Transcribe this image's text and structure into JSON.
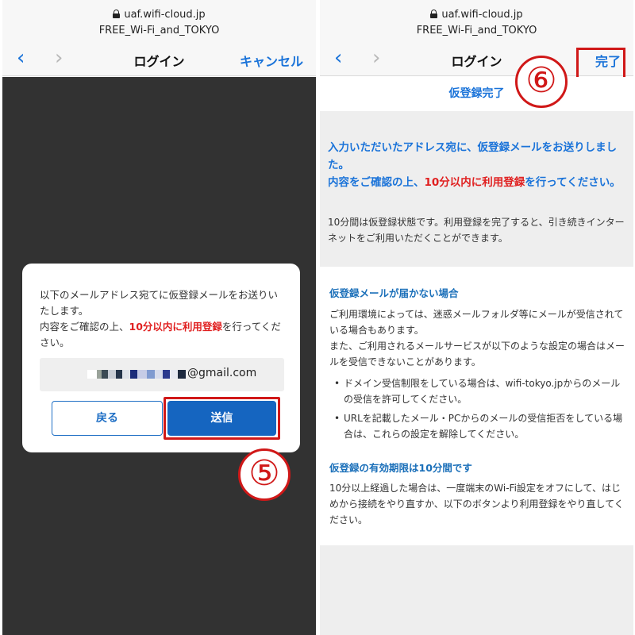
{
  "left": {
    "url": "uaf.wifi-cloud.jp",
    "ssid": "FREE_Wi-Fi_and_TOKYO",
    "nav_back": "‹",
    "nav_forward": "›",
    "nav_title": "ログイン",
    "nav_action": "キャンセル",
    "dialog": {
      "text_line1": "以下のメールアドレス宛てに仮登録メールをお送りいたします。",
      "text_prefix": "内容をご確認の上、",
      "text_highlight": "10分以内に利用登録",
      "text_suffix": "を行ってください。",
      "email_domain": "@gmail.com",
      "back_label": "戻る",
      "send_label": "送信"
    },
    "step_badge": "⑤"
  },
  "right": {
    "url": "uaf.wifi-cloud.jp",
    "ssid": "FREE_Wi-Fi_and_TOKYO",
    "nav_back": "‹",
    "nav_forward": "›",
    "nav_title": "ログイン",
    "nav_action": "完了",
    "step_badge": "⑥",
    "reg_title": "仮登録完了",
    "lead_line1": "入力いただいたアドレス宛に、仮登録メールをお送りしました。",
    "lead_prefix": "内容をご確認の上、",
    "lead_highlight": "10分以内に利用登録",
    "lead_suffix": "を行ってください。",
    "note": "10分間は仮登録状態です。利用登録を完了すると、引き続きインターネットをご利用いただくことができます。",
    "section1_heading": "仮登録メールが届かない場合",
    "section1_body1": "ご利用環境によっては、迷惑メールフォルダ等にメールが受信されている場合もあります。",
    "section1_body2": "また、ご利用されるメールサービスが以下のような設定の場合はメールを受信できないことがあります。",
    "bullet1": "ドメイン受信制限をしている場合は、wifi-tokyo.jpからのメールの受信を許可してください。",
    "bullet2": "URLを記載したメール・PCからのメールの受信拒否をしている場合は、これらの設定を解除してください。",
    "section2_heading": "仮登録の有効期限は10分間です",
    "section2_body": "10分以上経過した場合は、一度端末のWi-Fi設定をオフにして、はじめから接続をやり直すか、以下のボタンより利用登録をやり直してください。"
  },
  "colors": {
    "accent_blue": "#1a73d9",
    "button_blue": "#1565c0",
    "highlight_red": "#e02020",
    "annotation_red": "#d01818",
    "overlay": "#323232"
  }
}
